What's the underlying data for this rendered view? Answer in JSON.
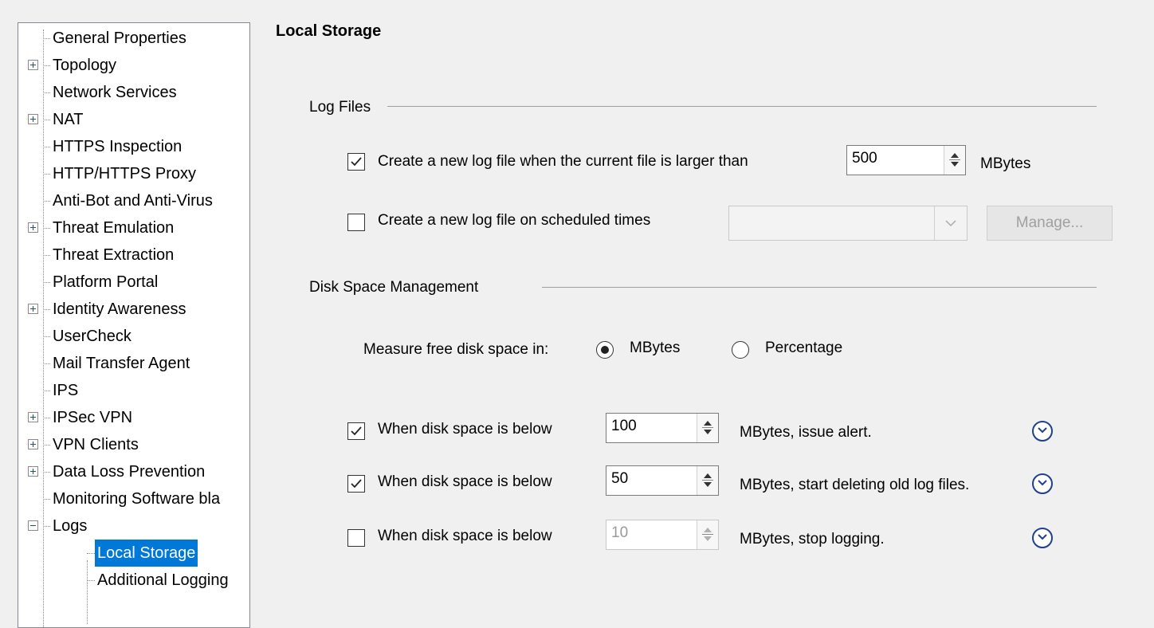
{
  "tree": {
    "items": [
      {
        "label": "General Properties",
        "expandable": false
      },
      {
        "label": "Topology",
        "expandable": true
      },
      {
        "label": "Network Services",
        "expandable": false
      },
      {
        "label": "NAT",
        "expandable": true
      },
      {
        "label": "HTTPS Inspection",
        "expandable": false
      },
      {
        "label": "HTTP/HTTPS Proxy",
        "expandable": false
      },
      {
        "label": "Anti-Bot and Anti-Virus",
        "expandable": false
      },
      {
        "label": "Threat Emulation",
        "expandable": true
      },
      {
        "label": "Threat Extraction",
        "expandable": false
      },
      {
        "label": "Platform Portal",
        "expandable": false
      },
      {
        "label": "Identity Awareness",
        "expandable": true
      },
      {
        "label": "UserCheck",
        "expandable": false
      },
      {
        "label": "Mail Transfer Agent",
        "expandable": false
      },
      {
        "label": "IPS",
        "expandable": false
      },
      {
        "label": "IPSec VPN",
        "expandable": true
      },
      {
        "label": "VPN Clients",
        "expandable": true
      },
      {
        "label": "Data Loss Prevention",
        "expandable": true
      },
      {
        "label": "Monitoring Software bla",
        "expandable": false
      },
      {
        "label": "Logs",
        "expandable": true,
        "expanded": true
      },
      {
        "label": "Local Storage",
        "child": true,
        "selected": true
      },
      {
        "label": "Additional Logging",
        "child": true
      }
    ]
  },
  "page": {
    "title": "Local Storage"
  },
  "log_files": {
    "section_title": "Log Files",
    "size_rotation": {
      "checked": true,
      "label": "Create a new log file when the current file is larger than",
      "value": "500",
      "unit": "MBytes"
    },
    "scheduled_rotation": {
      "checked": false,
      "label": "Create a new log file on scheduled times",
      "selected_value": "",
      "manage_label": "Manage..."
    }
  },
  "disk_space": {
    "section_title": "Disk Space Management",
    "measure_label": "Measure free disk space in:",
    "options": [
      {
        "label": "MBytes",
        "selected": true
      },
      {
        "label": "Percentage",
        "selected": false
      }
    ],
    "rules": [
      {
        "checked": true,
        "label": "When disk space is below",
        "value": "100",
        "suffix": "MBytes, issue alert.",
        "enabled": true
      },
      {
        "checked": true,
        "label": "When disk space is below",
        "value": "50",
        "suffix": "MBytes, start deleting old log files.",
        "enabled": true
      },
      {
        "checked": false,
        "label": "When disk space is below",
        "value": "10",
        "suffix": "MBytes, stop logging.",
        "enabled": false
      }
    ]
  },
  "colors": {
    "selection": "#0078d7",
    "expand_icon": "#1f3f8f"
  }
}
